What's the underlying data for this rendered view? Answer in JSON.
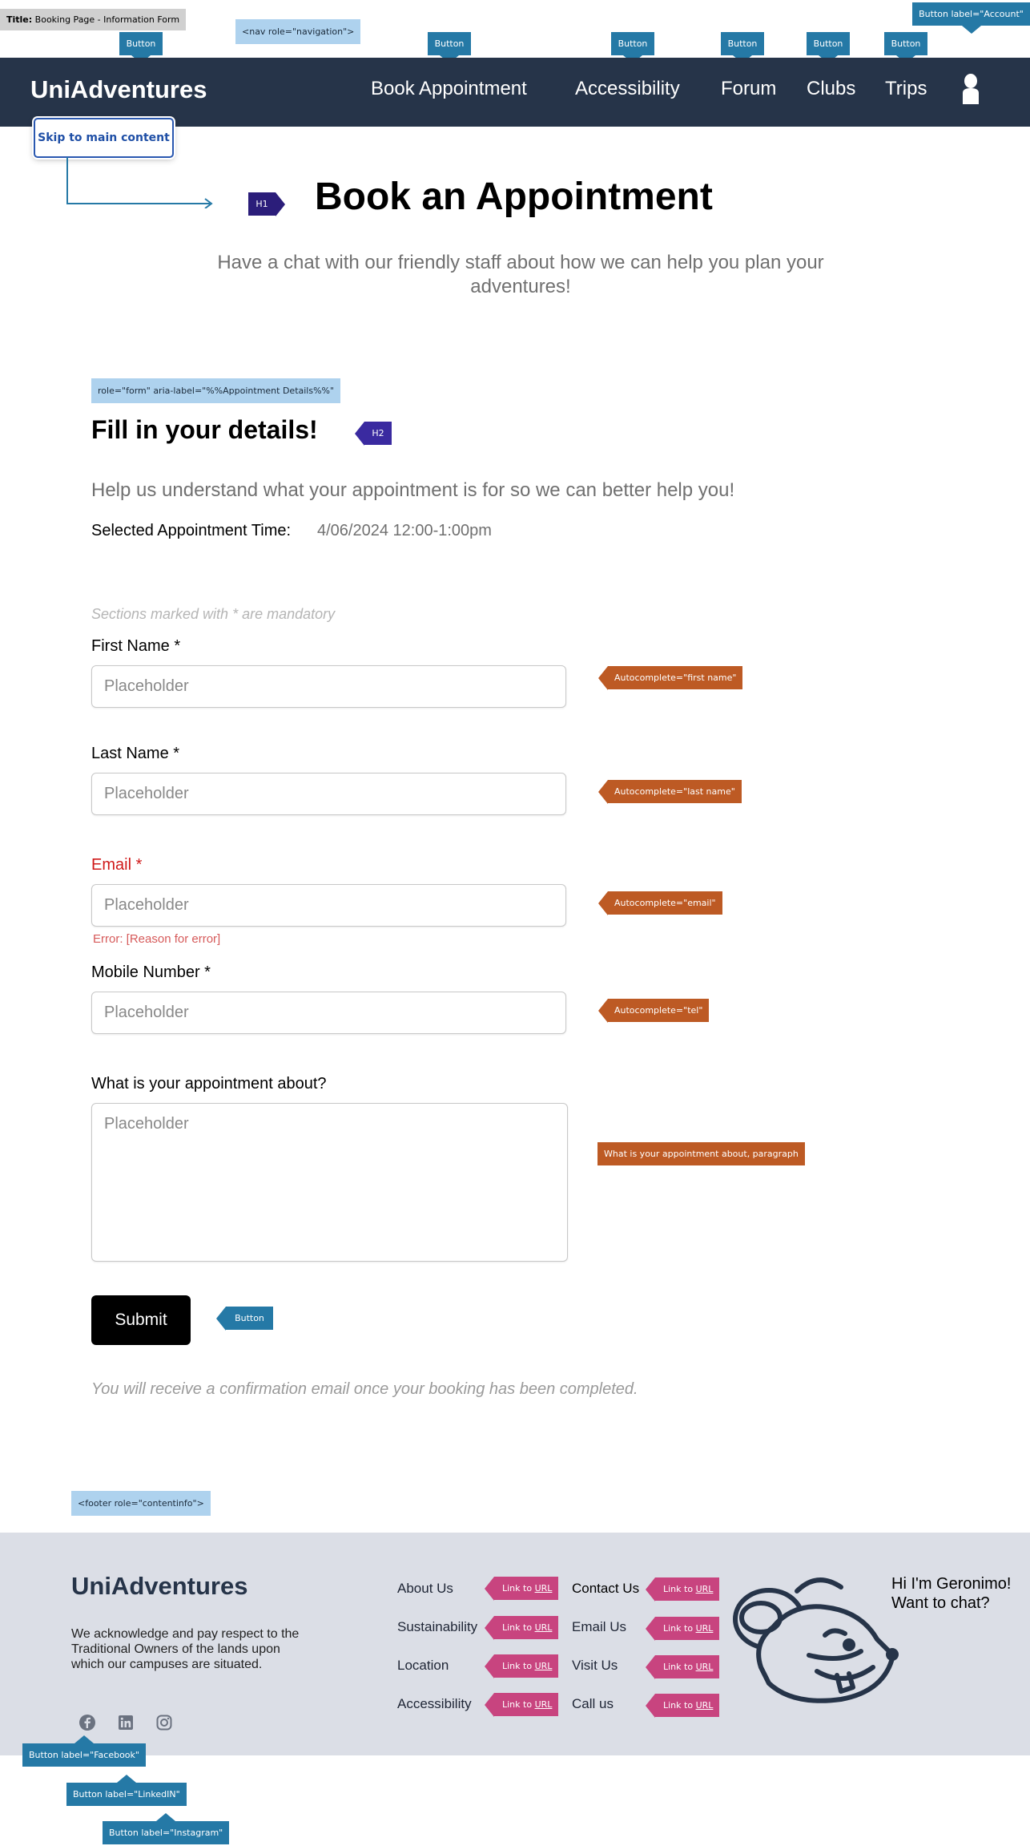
{
  "annotations": {
    "title_prefix": "Title:",
    "title_value": "Booking Page - Information Form",
    "nav_role": "<nav role=\"navigation\">",
    "button": "Button",
    "account_button": "Button label=\"Account\"",
    "form_role": "role=\"form\" aria-label=\"%%Appointment Details%%\"",
    "h1": "H1",
    "h2": "H2",
    "autocomplete_first": "Autocomplete=\"first name\"",
    "autocomplete_last": "Autocomplete=\"last name\"",
    "autocomplete_email": "Autocomplete=\"email\"",
    "autocomplete_tel": "Autocomplete=\"tel\"",
    "appointment_para": "What is your appointment about, paragraph",
    "footer_role": "<footer role=\"contentinfo\">",
    "link_prefix": "Link to ",
    "link_url": "URL",
    "facebook_button": "Button label=\"Facebook\"",
    "linkedin_button": "Button label=\"LinkedIN\"",
    "instagram_button": "Button label=\"Instagram\""
  },
  "header": {
    "brand": "UniAdventures",
    "nav": [
      "Book Appointment",
      "Accessibility",
      "Forum",
      "Clubs",
      "Trips"
    ],
    "account_icon": "person-icon"
  },
  "skip_link": "Skip to main content",
  "hero": {
    "title": "Book an Appointment",
    "subtitle": "Have a chat with our friendly staff about how we can help you plan your adventures!"
  },
  "form": {
    "heading": "Fill in your details!",
    "help": "Help us understand what your appointment is for so we can better help you!",
    "selected_time_label": "Selected Appointment Time:",
    "selected_time_value": "4/06/2024  12:00-1:00pm",
    "mandatory_note": "Sections marked with * are mandatory",
    "first_name_label": "First Name *",
    "last_name_label": "Last Name *",
    "email_label": "Email *",
    "mobile_label": "Mobile Number *",
    "about_label": "What is your appointment about?",
    "placeholder": "Placeholder",
    "email_error": "Error: [Reason for error]",
    "submit": "Submit",
    "confirmation": "You will receive a confirmation email once your booking has been completed."
  },
  "footer": {
    "brand": "UniAdventures",
    "acknowledgement": "We acknowledge and pay respect to the Traditional Owners of the lands upon which our campuses are situated.",
    "col1": [
      "About Us",
      "Sustainability",
      "Location",
      "Accessibility"
    ],
    "col2": [
      "Contact Us",
      "Email Us",
      "Visit Us",
      "Call us"
    ],
    "chat": "Hi I'm Geronimo! Want to chat?",
    "social_icons": [
      "facebook-icon",
      "linkedin-icon",
      "instagram-icon"
    ]
  },
  "colors": {
    "header_bg": "#263449",
    "footer_bg": "#dbdee6",
    "annotation_button": "#2579a6",
    "annotation_autocomplete": "#bd5a24",
    "annotation_link": "#c8447f",
    "annotation_heading": "#2b1d7a",
    "error": "#d01a1a"
  }
}
